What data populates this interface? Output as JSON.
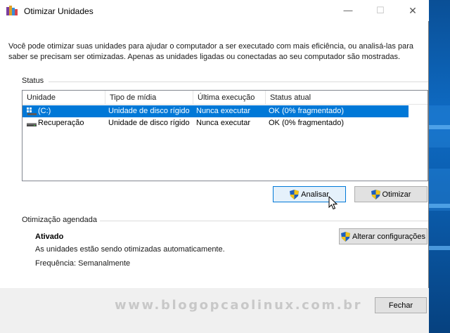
{
  "window": {
    "title": "Otimizar Unidades",
    "icon": "defrag-app-icon",
    "controls": {
      "minimize": "—",
      "maximize": "☐",
      "close": "✕"
    }
  },
  "intro_text": "Você pode otimizar suas unidades para ajudar o computador a ser executado com mais eficiência, ou analisá-las para saber se precisam ser otimizadas. Apenas as unidades ligadas ou conectadas ao seu computador são mostradas.",
  "status": {
    "label": "Status",
    "columns": [
      "Unidade",
      "Tipo de mídia",
      "Última execução",
      "Status atual"
    ],
    "rows": [
      {
        "drive": "(C:)",
        "media": "Unidade de disco rígido",
        "last_run": "Nunca executar",
        "status": "OK (0% fragmentado)",
        "selected": true,
        "icon": "windows-drive-icon"
      },
      {
        "drive": "Recuperação",
        "media": "Unidade de disco rígido",
        "last_run": "Nunca executar",
        "status": "OK (0% fragmentado)",
        "selected": false,
        "icon": "hard-drive-icon"
      }
    ],
    "analyze_label": "Analisar",
    "optimize_label": "Otimizar"
  },
  "scheduled": {
    "label": "Otimização agendada",
    "state": "Ativado",
    "description": "As unidades estão sendo otimizadas automaticamente.",
    "frequency": "Frequência: Semanalmente",
    "change_settings_label": "Alterar configurações"
  },
  "footer": {
    "close_label": "Fechar",
    "watermark": "www.blogopcaolinux.com.br"
  },
  "colors": {
    "selection": "#0078d7",
    "button": "#e1e1e1",
    "button_focused": "#e5f1fb",
    "footer": "#f0f0f0",
    "desktop": "#0c5aa0"
  }
}
